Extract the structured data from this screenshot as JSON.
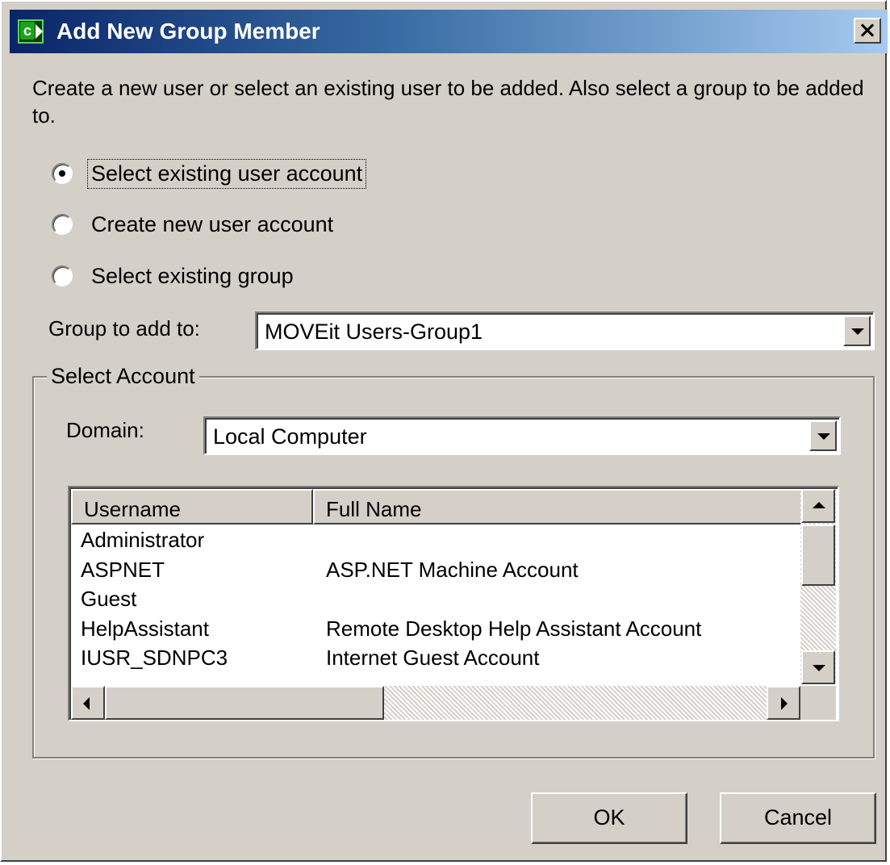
{
  "window": {
    "title": "Add New Group Member",
    "close_label": "X"
  },
  "instructions": "Create a new user or select an existing user to be added. Also select a group to be added to.",
  "radios": [
    {
      "label": "Select existing user account",
      "checked": true
    },
    {
      "label": "Create new user account",
      "checked": false
    },
    {
      "label": "Select existing group",
      "checked": false
    }
  ],
  "group": {
    "label": "Group to add to:",
    "value": "MOVEit Users-Group1"
  },
  "select_account": {
    "title": "Select Account",
    "domain_label": "Domain:",
    "domain_value": "Local Computer",
    "columns": [
      "Username",
      "Full Name"
    ],
    "rows": [
      {
        "username": "Administrator",
        "full_name": ""
      },
      {
        "username": "ASPNET",
        "full_name": "ASP.NET Machine Account"
      },
      {
        "username": "Guest",
        "full_name": ""
      },
      {
        "username": "HelpAssistant",
        "full_name": "Remote Desktop Help Assistant Account"
      },
      {
        "username": "IUSR_SDNPC3",
        "full_name": "Internet Guest Account"
      }
    ]
  },
  "buttons": {
    "ok": "OK",
    "cancel": "Cancel"
  },
  "icons": {
    "app": "moveit-central-icon",
    "close": "close-icon"
  },
  "colors": {
    "titlebar_start": "#0a246a",
    "titlebar_end": "#a6caf0",
    "face": "#d4d0c8"
  }
}
